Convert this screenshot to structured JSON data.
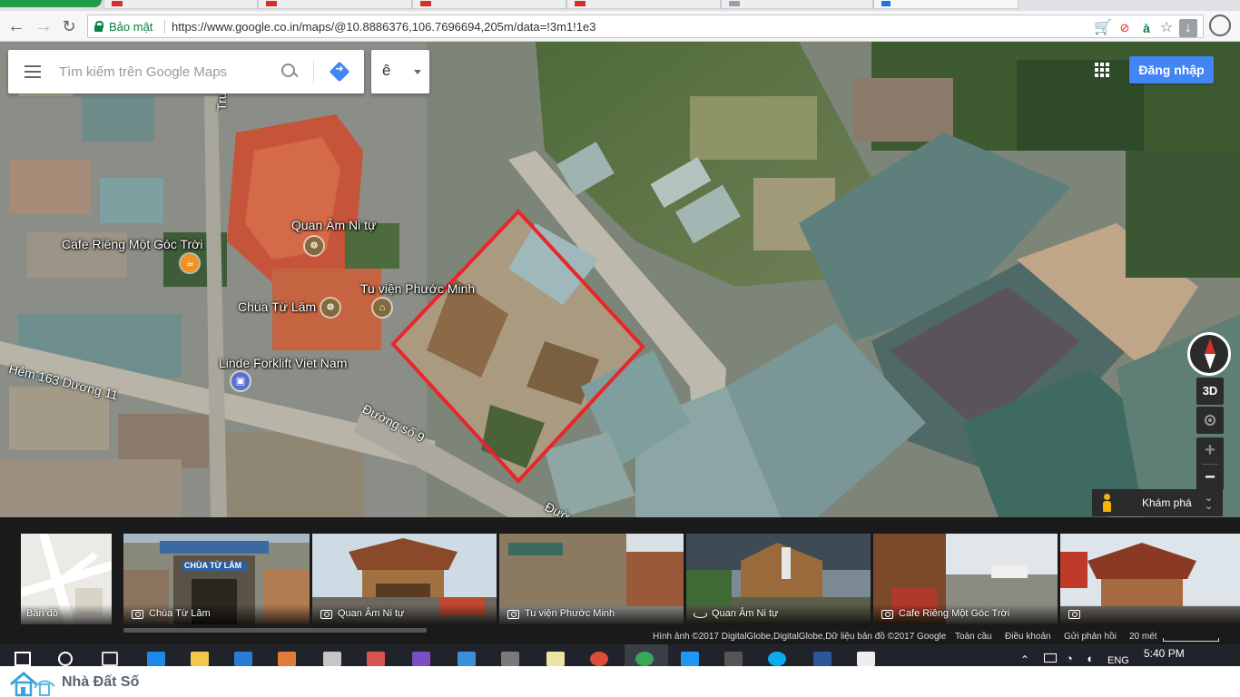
{
  "browser": {
    "secure_label": "Bảo mật",
    "url": "https://www.google.co.in/maps/@10.8886376,106.7696694,205m/data=!3m1!1e3"
  },
  "search": {
    "placeholder": "Tìm kiếm trên Google Maps",
    "lang": "ê"
  },
  "header": {
    "signin_label": "Đăng nhập"
  },
  "map": {
    "place_labels": [
      {
        "name": "quan-am-ni-tu",
        "text": "Quan Âm Ni tự"
      },
      {
        "name": "cafe-rieng",
        "text": "Cafe Riêng Một Góc Trời"
      },
      {
        "name": "tu-vien-phuoc-minh",
        "text": "Tu viện Phước Minh"
      },
      {
        "name": "chua-tu-lam",
        "text": "Chùa Từ Lâm"
      },
      {
        "name": "linde-forklift",
        "text": "Linde Forklift Viet Nam"
      }
    ],
    "road_labels": [
      {
        "name": "hem-163",
        "text": "Hẻm 163 Dương 11"
      },
      {
        "name": "duong-so-9",
        "text": "Đường số 9"
      },
      {
        "name": "duong-partial",
        "text": "Đườ"
      },
      {
        "name": "truong-partial",
        "text": "Trư"
      }
    ],
    "controls": {
      "view_3d": "3D",
      "zoom_in": "+",
      "zoom_out": "−",
      "explore": "Khám phá"
    },
    "highlight_color": "#e8262b"
  },
  "filmstrip": {
    "items": [
      {
        "name": "map-thumb",
        "label": "Bản đồ",
        "icon": "none"
      },
      {
        "name": "photo-chua-tu-lam",
        "label": "Chùa Từ Lâm",
        "icon": "camera-icon",
        "sign": "CHÙA TỪ LÂM"
      },
      {
        "name": "photo-quan-am-1",
        "label": "Quan Âm Ni tự",
        "icon": "camera-icon"
      },
      {
        "name": "photo-tu-vien",
        "label": "Tu viện Phước Minh",
        "icon": "camera-icon"
      },
      {
        "name": "photo-quan-am-2",
        "label": "Quan Âm Ni tự",
        "icon": "panorama-icon"
      },
      {
        "name": "photo-cafe",
        "label": "Cafe Riêng Một Góc Trời",
        "icon": "camera-icon"
      },
      {
        "name": "photo-last",
        "label": "",
        "icon": "camera-icon"
      }
    ]
  },
  "footer": {
    "attribution": "Hình ảnh ©2017 DigitalGlobe,DigitalGlobe,Dữ liệu bản đồ ©2017 Google",
    "global": "Toàn cầu",
    "terms": "Điều khoản",
    "feedback": "Gửi phản hồi",
    "scale": "20 mét"
  },
  "taskbar": {
    "lang": "ENG",
    "time": "5:40 PM"
  },
  "watermark": {
    "brand": "Nhà Đất Số"
  }
}
